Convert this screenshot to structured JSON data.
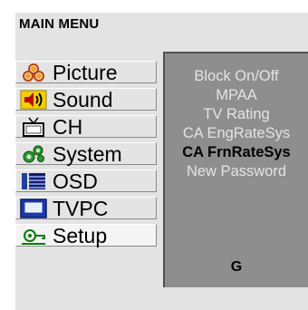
{
  "menu_title": "MAIN MENU",
  "main_menu": {
    "items": [
      {
        "label": "Picture",
        "icon": "picture-icon"
      },
      {
        "label": "Sound",
        "icon": "sound-icon"
      },
      {
        "label": "CH",
        "icon": "tv-icon"
      },
      {
        "label": "System",
        "icon": "system-icon"
      },
      {
        "label": "OSD",
        "icon": "osd-icon"
      },
      {
        "label": "TVPC",
        "icon": "monitor-icon"
      },
      {
        "label": "Setup",
        "icon": "setup-icon"
      }
    ],
    "active_item": "Setup"
  },
  "submenu": {
    "items": [
      {
        "label": "Block On/Off"
      },
      {
        "label": "MPAA"
      },
      {
        "label": "TV Rating"
      },
      {
        "label": "CA EngRateSys"
      },
      {
        "label": "CA FrnRateSys"
      },
      {
        "label": "New Password"
      }
    ],
    "selected_item": "CA FrnRateSys",
    "rating_value": "G"
  },
  "colors": {
    "panel_bg": "#e3e3e3",
    "submenu_bg": "#8e8e8e",
    "submenu_text": "#e4e4e4",
    "selected_text": "#000000"
  }
}
